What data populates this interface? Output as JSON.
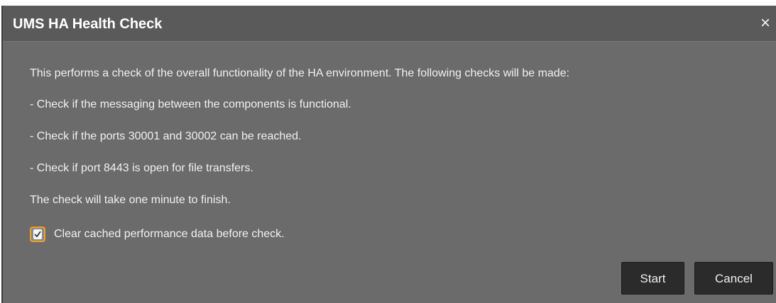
{
  "dialog": {
    "title": "UMS HA Health Check",
    "close_icon": "×"
  },
  "body": {
    "intro": "This performs a check of the overall functionality of the HA environment. The following checks will be made:",
    "checks": [
      "- Check if the messaging between the components is functional.",
      "- Check if the ports 30001 and 30002 can be reached.",
      "- Check if port 8443 is open for file transfers."
    ],
    "duration_note": "The check will take one minute to finish."
  },
  "option": {
    "label": "Clear cached performance data before check.",
    "checked": true,
    "accent_color": "#f0a020"
  },
  "buttons": {
    "start": "Start",
    "cancel": "Cancel"
  }
}
